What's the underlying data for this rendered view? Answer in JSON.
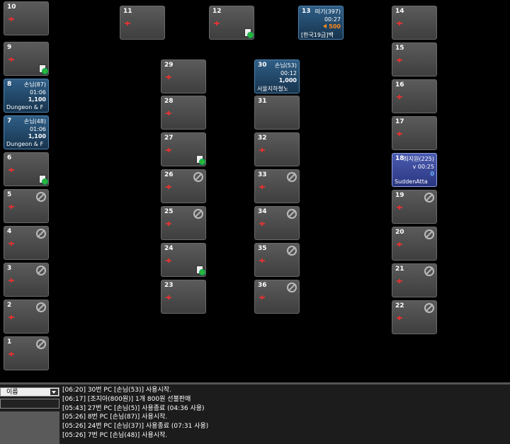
{
  "pcs": [
    {
      "num": "10",
      "state": "idle",
      "flag": "none"
    },
    {
      "num": "9",
      "state": "idle",
      "flag": "memo"
    },
    {
      "num": "8",
      "state": "busy",
      "user": "손님(87)",
      "time": "01:06",
      "amount": "1,100",
      "game": "Dungeon & F"
    },
    {
      "num": "7",
      "state": "busy",
      "user": "손님(48)",
      "time": "01:06",
      "amount": "1,100",
      "game": "Dungeon & F"
    },
    {
      "num": "6",
      "state": "idle",
      "flag": "memo"
    },
    {
      "num": "5",
      "state": "idle",
      "flag": "ban"
    },
    {
      "num": "4",
      "state": "idle",
      "flag": "ban"
    },
    {
      "num": "3",
      "state": "idle",
      "flag": "ban"
    },
    {
      "num": "2",
      "state": "idle",
      "flag": "ban"
    },
    {
      "num": "1",
      "state": "idle",
      "flag": "ban"
    },
    {
      "num": "11",
      "state": "idle",
      "flag": "none"
    },
    {
      "num": "12",
      "state": "idle",
      "flag": "memo"
    },
    {
      "num": "13",
      "state": "busy",
      "user": "떠기(397)",
      "time": "00:27",
      "amount": "500",
      "amount_style": "orange",
      "game": "[한국19금]백"
    },
    {
      "num": "14",
      "state": "idle",
      "flag": "none"
    },
    {
      "num": "15",
      "state": "idle",
      "flag": "none"
    },
    {
      "num": "16",
      "state": "idle",
      "flag": "none"
    },
    {
      "num": "17",
      "state": "idle",
      "flag": "none"
    },
    {
      "num": "18",
      "state": "busy-sel",
      "user": "최지원(225)",
      "time": "v 00:25",
      "amount": "0",
      "amount_style": "blue",
      "game": "SuddenAtta"
    },
    {
      "num": "19",
      "state": "idle",
      "flag": "ban"
    },
    {
      "num": "20",
      "state": "idle",
      "flag": "ban"
    },
    {
      "num": "21",
      "state": "idle",
      "flag": "ban"
    },
    {
      "num": "22",
      "state": "idle",
      "flag": "ban"
    },
    {
      "num": "29",
      "state": "idle",
      "flag": "none"
    },
    {
      "num": "28",
      "state": "idle",
      "flag": "none"
    },
    {
      "num": "27",
      "state": "idle",
      "flag": "memo"
    },
    {
      "num": "26",
      "state": "idle",
      "flag": "ban"
    },
    {
      "num": "25",
      "state": "idle",
      "flag": "ban"
    },
    {
      "num": "24",
      "state": "idle",
      "flag": "memo"
    },
    {
      "num": "23",
      "state": "idle",
      "flag": "none"
    },
    {
      "num": "30",
      "state": "busy",
      "user": "손님(53)",
      "time": "00:12",
      "amount": "1,000",
      "game": "서울지하철노"
    },
    {
      "num": "31",
      "state": "idle",
      "flag": "none",
      "noicon": true
    },
    {
      "num": "32",
      "state": "idle",
      "flag": "none"
    },
    {
      "num": "33",
      "state": "idle",
      "flag": "ban"
    },
    {
      "num": "34",
      "state": "idle",
      "flag": "ban"
    },
    {
      "num": "35",
      "state": "idle",
      "flag": "ban"
    },
    {
      "num": "36",
      "state": "idle",
      "flag": "ban"
    }
  ],
  "sort_select": {
    "label": "이름"
  },
  "log": [
    {
      "text": "[06:20] 30번 PC [손님(53)] 사용시작."
    },
    {
      "text": "[06:17] [조지아(800원)] 1개 800원 선불판매"
    },
    {
      "text": "[05:43] 27번 PC [손님(5)] 사용종료 (04:36 사용)"
    },
    {
      "text": "[05:26] 8번 PC [손님(87)] 사용시작."
    },
    {
      "text": "[05:26] 24번 PC [손님(37)] 사용종료 (07:31 사용)"
    },
    {
      "text": "[05:26] 7번 PC [손님(48)] 사용시작."
    }
  ],
  "colors": {
    "busy": "#2f5e86",
    "selected": "#4b5cb0",
    "orange": "#ff8a1a",
    "log_alert": "#ff5a1a"
  }
}
